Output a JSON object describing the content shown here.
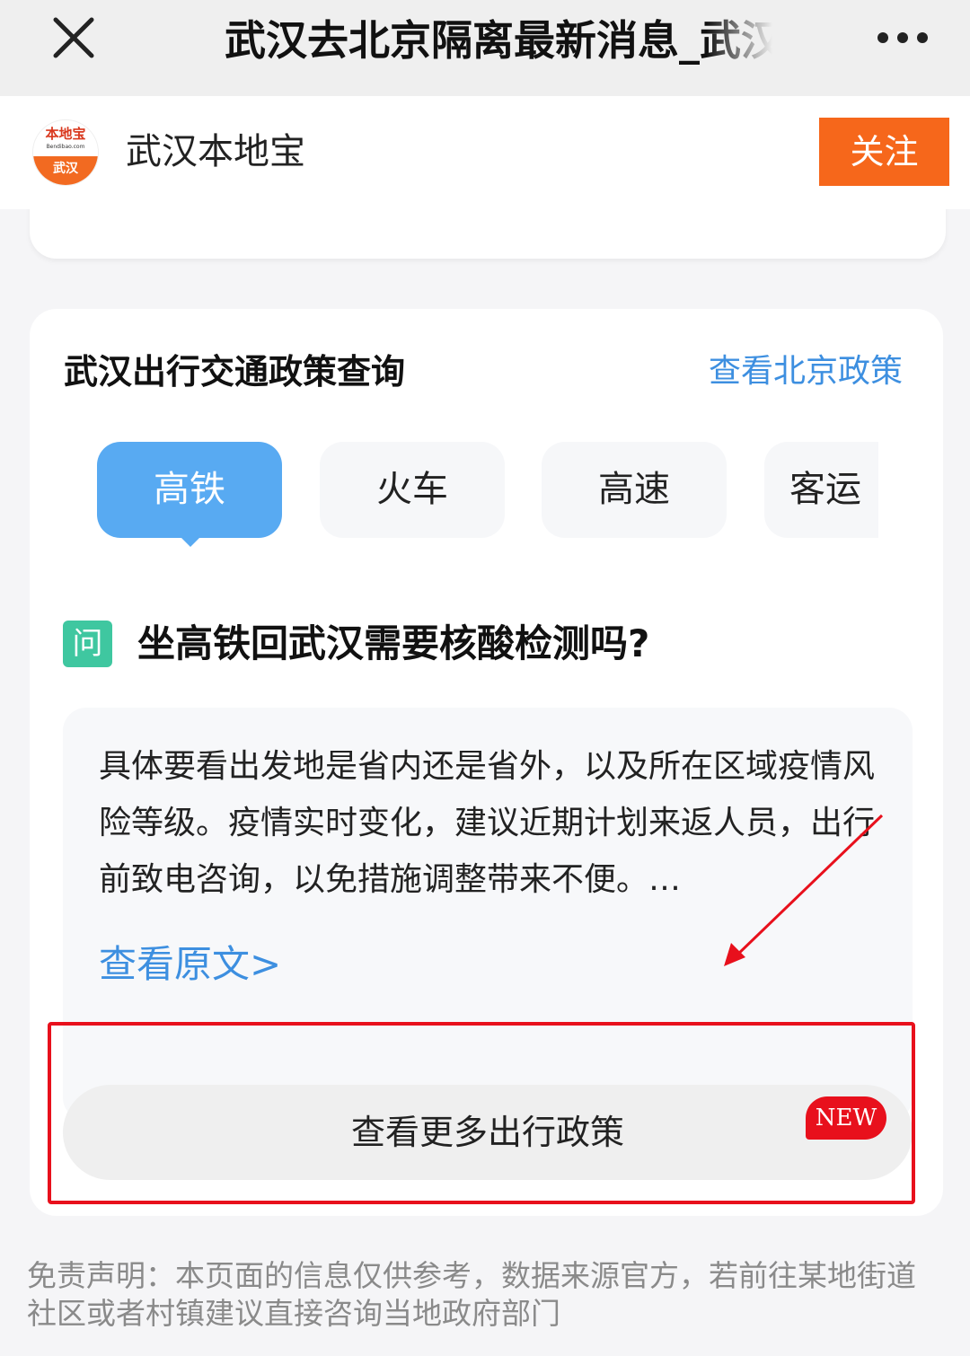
{
  "topbar": {
    "title": "武汉去北京隔离最新消息_武汉本地宝"
  },
  "account": {
    "logo_top": "本地宝",
    "logo_sub": "Bendibao.com",
    "logo_city": "武汉",
    "name": "武汉本地宝",
    "follow_label": "关注"
  },
  "card": {
    "title": "武汉出行交通政策查询",
    "link_label": "查看北京政策",
    "tabs": [
      {
        "label": "高铁"
      },
      {
        "label": "火车"
      },
      {
        "label": "高速"
      },
      {
        "label": "客运"
      }
    ],
    "active_tab": "高铁",
    "q_badge": "问",
    "question": "坐高铁回武汉需要核酸检测吗?",
    "answer": "具体要看出发地是省内还是省外，以及所在区域疫情风险等级。疫情实时变化，建议近期计划来返人员，出行前致电咨询，以免措施调整带来不便。…",
    "view_original": "查看原文>",
    "more_policy_label": "查看更多出行政策",
    "new_badge": "NEW"
  },
  "disclaimer": "免责声明：本页面的信息仅供参考，数据来源官方，若前往某地街道社区或者村镇建议直接咨询当地政府部门",
  "colors": {
    "accent_blue": "#3d8fe0",
    "tab_active": "#58aaf2",
    "follow_orange": "#f6671b",
    "annotation_red": "#e8101c",
    "question_badge": "#3fc7a0"
  },
  "icons": {
    "close": "close-icon",
    "more": "more-dots-icon",
    "annotation_arrow": "red-arrow-icon"
  }
}
